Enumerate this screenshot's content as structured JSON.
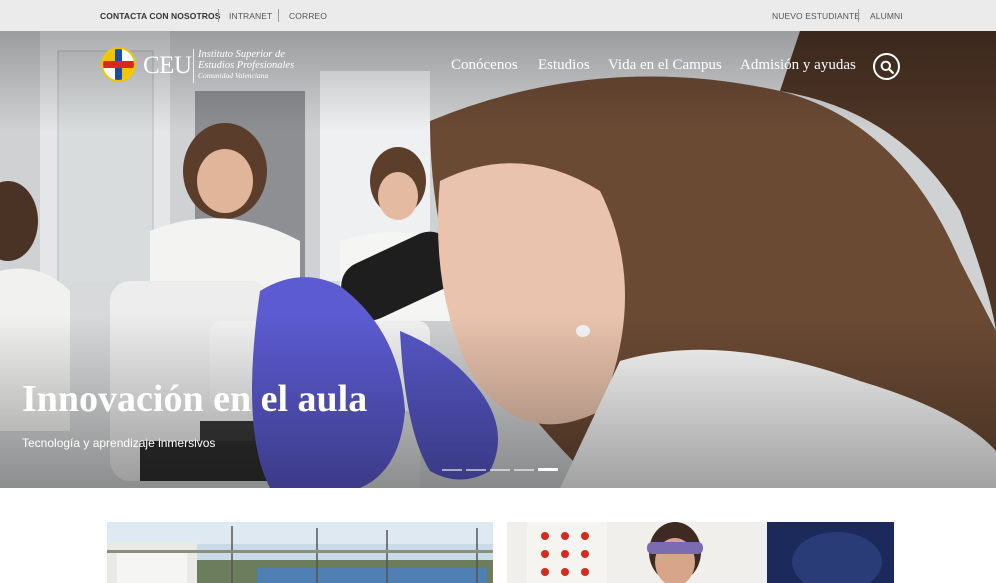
{
  "topbar": {
    "left_links": [
      "CONTACTA CON NOSOTROS",
      "INTRANET",
      "CORREO"
    ],
    "right_links": [
      "NUEVO ESTUDIANTE",
      "ALUMNI"
    ]
  },
  "logo": {
    "brand": "CEU",
    "line1": "Instituto Superior de",
    "line2": "Estudios Profesionales",
    "line3": "Comunidad Valenciana"
  },
  "nav": {
    "items": [
      "Conócenos",
      "Estudios",
      "Vida en el Campus",
      "Admisión y ayudas"
    ],
    "search_icon": "search-icon"
  },
  "hero": {
    "title": "Innovación en el aula",
    "subtitle": "Tecnología y aprendizaje inmersivos",
    "slides_total": 5,
    "active_slide": 5
  },
  "colors": {
    "topbar_bg": "#ebebeb",
    "logo_yellow": "#f1c400",
    "logo_red": "#d52b1e",
    "logo_blue": "#1d4e9e"
  }
}
